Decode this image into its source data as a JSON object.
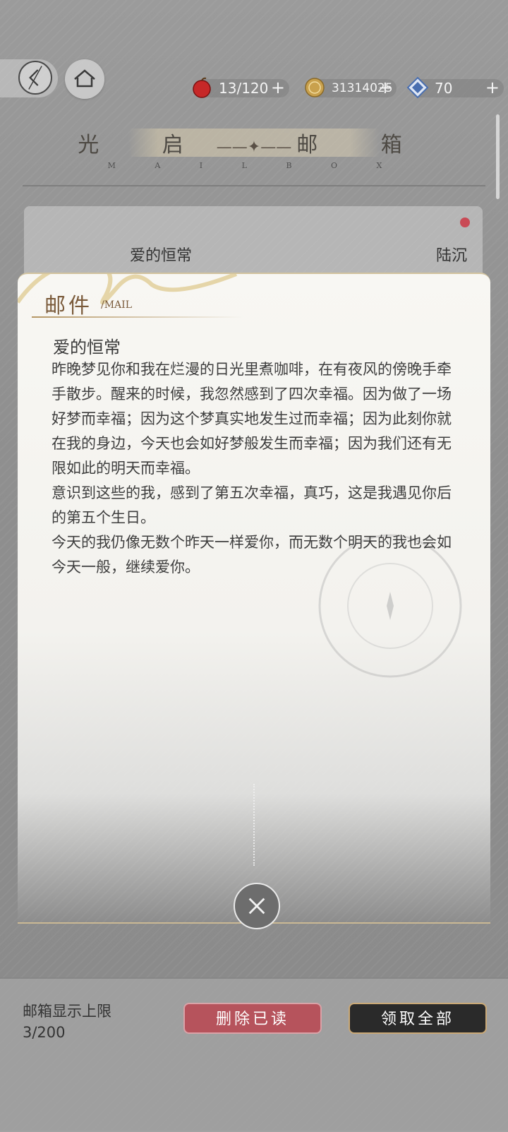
{
  "topbar": {
    "currencies": [
      {
        "name": "apple-icon",
        "value": "13/120",
        "color": "#c62828"
      },
      {
        "name": "gold-coin-icon",
        "value": "3131402 5",
        "color": "#c9a14d"
      },
      {
        "name": "crystal-icon",
        "value": "70",
        "color": "#4a6fb0"
      }
    ]
  },
  "header": {
    "title": "光启 ——✦—— 邮箱",
    "title_left": "光 启",
    "title_right": "邮 箱",
    "subtitle": "M A I L B O X"
  },
  "mail_list": {
    "items": [
      {
        "title": "爱的恒常",
        "sender": "陆沉",
        "unread": true
      }
    ]
  },
  "mail_modal": {
    "header": "邮件",
    "header_sub": "/MAIL",
    "title": "爱的恒常",
    "paragraphs": [
      "昨晚梦见你和我在烂漫的日光里煮咖啡，在有夜风的傍晚手牵手散步。醒来的时候，我忽然感到了四次幸福。因为做了一场好梦而幸福；因为这个梦真实地发生过而幸福；因为此刻你就在我的身边，今天也会如好梦般发生而幸福；因为我们还有无限如此的明天而幸福。",
      "意识到这些的我，感到了第五次幸福，真巧，这是我遇见你后的第五个生日。",
      "今天的我仍像无数个昨天一样爱你，而无数个明天的我也会如今天一般，继续爱你。"
    ]
  },
  "bottom": {
    "limit_label": "邮箱显示上限",
    "limit_value": "3/200",
    "delete_read_label": "删除已读",
    "claim_all_label": "领取全部"
  },
  "colors": {
    "accent_gold": "#c9a977",
    "delete_red": "#b6535c",
    "unread_dot": "#c94a55"
  }
}
